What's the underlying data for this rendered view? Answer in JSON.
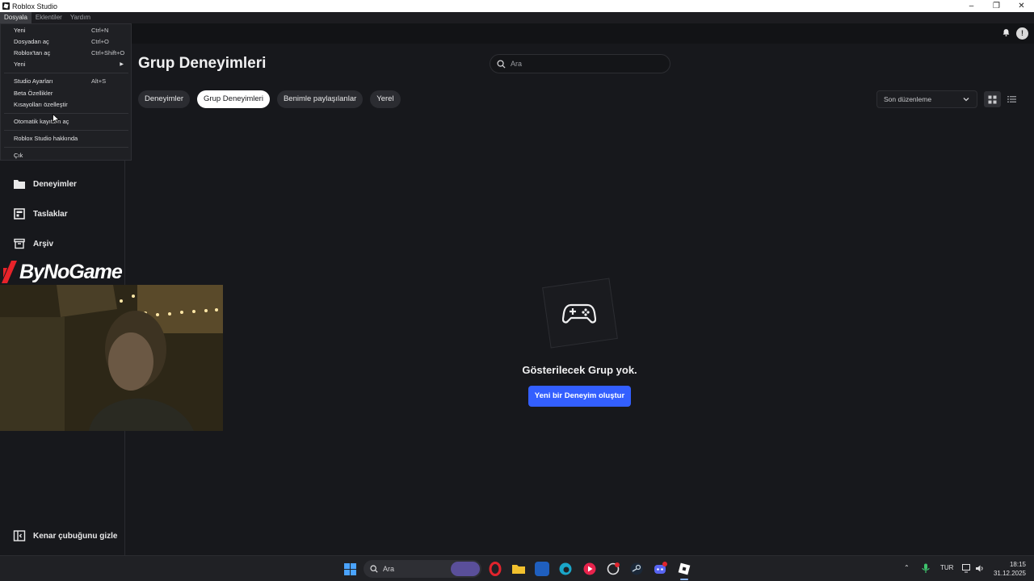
{
  "window": {
    "title": "Roblox Studio",
    "controls": [
      "minimize",
      "maximize",
      "close"
    ]
  },
  "menubar": {
    "items": [
      "Dosyala",
      "Eklentiler",
      "Yardım"
    ],
    "active": "Dosyala"
  },
  "file_menu": {
    "items": [
      {
        "label": "Yeni",
        "shortcut": "Ctrl+N"
      },
      {
        "label": "Dosyadan aç",
        "shortcut": "Ctrl+O"
      },
      {
        "label": "Roblox'tan aç",
        "shortcut": "Ctrl+Shift+O"
      },
      {
        "label": "Yeni",
        "shortcut": "",
        "submenu": true
      },
      {
        "label": "Studio Ayarları",
        "shortcut": "Alt+S"
      },
      {
        "label": "Beta Özellikler",
        "shortcut": ""
      },
      {
        "label": "Kısayolları özelleştir",
        "shortcut": ""
      },
      {
        "label": "Otomatik kayıttan aç",
        "shortcut": ""
      },
      {
        "label": "Roblox Studio hakkında",
        "shortcut": ""
      },
      {
        "label": "Çık",
        "shortcut": ""
      }
    ]
  },
  "sidebar": {
    "items": [
      {
        "label": "Deneyimler",
        "icon": "folder-icon"
      },
      {
        "label": "Taslaklar",
        "icon": "template-icon"
      },
      {
        "label": "Arşiv",
        "icon": "archive-icon"
      }
    ],
    "footer": {
      "label": "Kenar çubuğunu gizle",
      "icon": "sidebar-toggle-icon"
    }
  },
  "main": {
    "title": "Grup Deneyimleri",
    "search_placeholder": "Ara",
    "tabs": [
      "Deneyimler",
      "Grup Deneyimleri",
      "Benimle paylaşılanlar",
      "Yerel"
    ],
    "active_tab": "Grup Deneyimleri",
    "sort_label": "Son düzenleme",
    "empty_state": {
      "message": "Gösterilecek Grup yok.",
      "button": "Yeni bir Deneyim oluştur",
      "icon": "gamepad-icon"
    }
  },
  "overlay": {
    "brand": "ByNoGame"
  },
  "taskbar": {
    "search_label": "Ara",
    "language": "TUR",
    "time": "18:15",
    "date": "31.12.2025"
  },
  "colors": {
    "background": "#17181c",
    "accent": "#335fff",
    "tab_active": "#ffffff"
  }
}
